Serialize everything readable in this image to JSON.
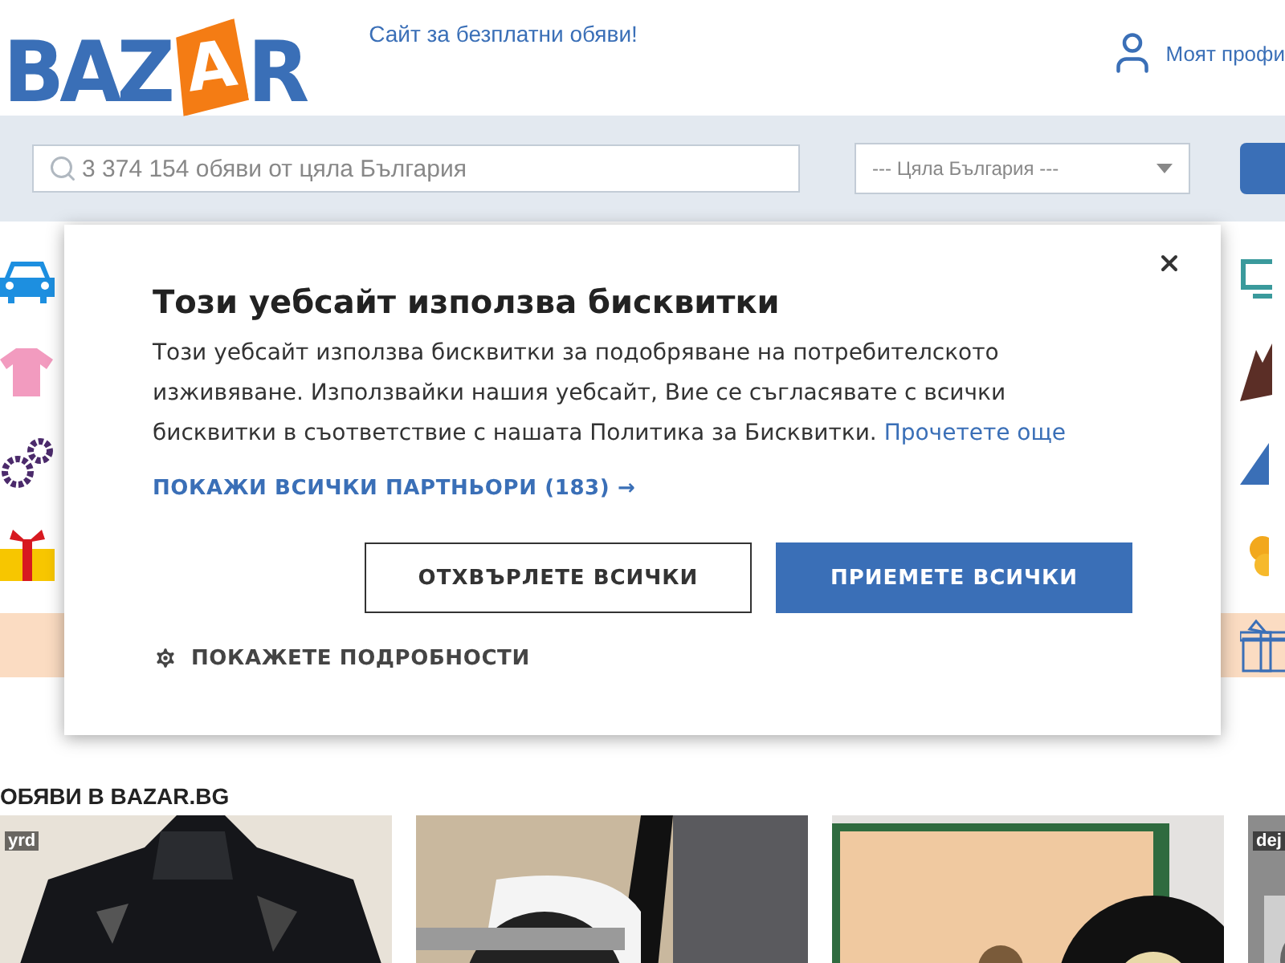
{
  "logo": {
    "before": "BAZ",
    "bag_letter": "A",
    "after": "R"
  },
  "tagline": "Сайт за безплатни обяви!",
  "profile_link": "Моят профи",
  "search": {
    "placeholder": "3 374 154 обяви от цяла България"
  },
  "location_select": {
    "value": "--- Цяла България ---"
  },
  "cookie_dialog": {
    "title": "Този уебсайт използва бисквитки",
    "body": "Този уебсайт използва бисквитки за подобряване на потребителското изживяване. Използвайки нашия уебсайт, Вие се съгласявате с всички бисквитки в съответствие с нашата Политика за Бисквитки.",
    "read_more": "Прочетете още",
    "partners_link": "ПОКАЖИ ВСИЧКИ ПАРТНЬОРИ (183) →",
    "reject_button": "ОТХВЪРЛЕТЕ ВСИЧКИ",
    "accept_button": "ПРИЕМЕТЕ ВСИЧКИ",
    "details_toggle": "ПОКАЖЕТЕ ПОДРОБНОСТИ"
  },
  "listings_heading": "ОБЯВИ В BAZAR.BG",
  "listings": [
    {
      "kind": "picture",
      "user": "yrd"
    },
    {
      "kind": "picture"
    },
    {
      "kind": "picture"
    },
    {
      "kind": "picture",
      "user": "dej"
    }
  ]
}
